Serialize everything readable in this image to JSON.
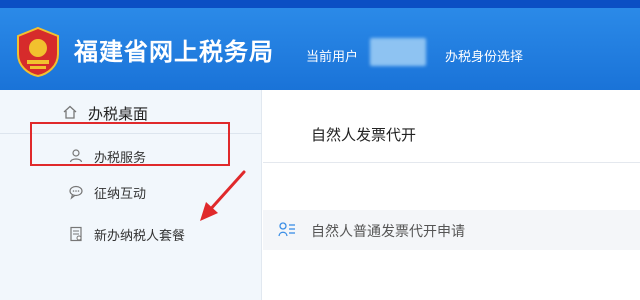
{
  "header": {
    "site_title": "福建省网上税务局",
    "current_user_label": "当前用户",
    "identity_select": "办税身份选择"
  },
  "sidebar": {
    "desk_label": "办税桌面",
    "items": [
      {
        "label": "办税服务",
        "icon": "user-icon"
      },
      {
        "label": "征纳互动",
        "icon": "chat-icon"
      },
      {
        "label": "新办纳税人套餐",
        "icon": "document-icon"
      }
    ]
  },
  "main": {
    "title": "自然人发票代开",
    "apps": [
      {
        "label": "自然人普通发票代开申请",
        "icon": "person-list-icon"
      }
    ]
  },
  "colors": {
    "header_bg": "#1a73d8",
    "top_strip": "#0b4fc4",
    "sidebar_bg": "#f2f7fc",
    "annotation_red": "#e0292b"
  }
}
